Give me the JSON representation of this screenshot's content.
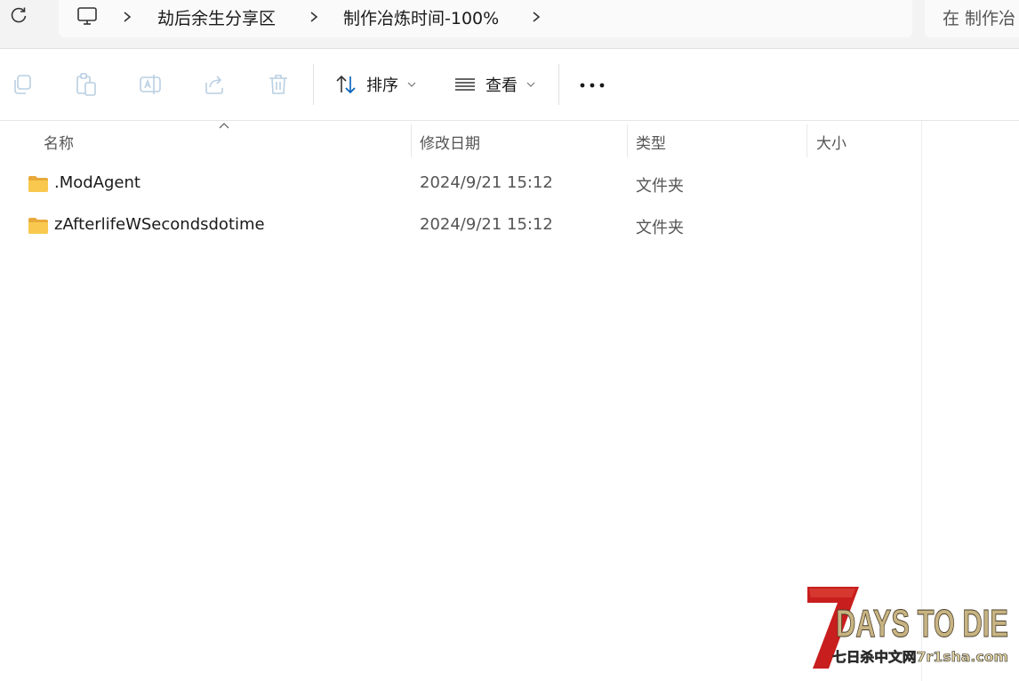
{
  "address_bar": {
    "breadcrumb": [
      "劫后余生分享区",
      "制作冶炼时间-100%"
    ],
    "search_placeholder": "在 制作冶"
  },
  "toolbar": {
    "sort_label": "排序",
    "view_label": "查看"
  },
  "columns": {
    "name": "名称",
    "modified": "修改日期",
    "type": "类型",
    "size": "大小"
  },
  "files": [
    {
      "name": ".ModAgent",
      "modified": "2024/9/21 15:12",
      "type": "文件夹",
      "size": ""
    },
    {
      "name": "zAfterlifeWSecondsdotime",
      "modified": "2024/9/21 15:12",
      "type": "文件夹",
      "size": ""
    }
  ],
  "watermark": {
    "logo_text": "7DAYS TO DIE",
    "site_text": "七日杀中文网7r1sha.com"
  },
  "colors": {
    "accent": "#005fb8",
    "folder": "#f8c94e",
    "logo_red": "#c81e1e",
    "logo_gold": "#c8b483"
  }
}
